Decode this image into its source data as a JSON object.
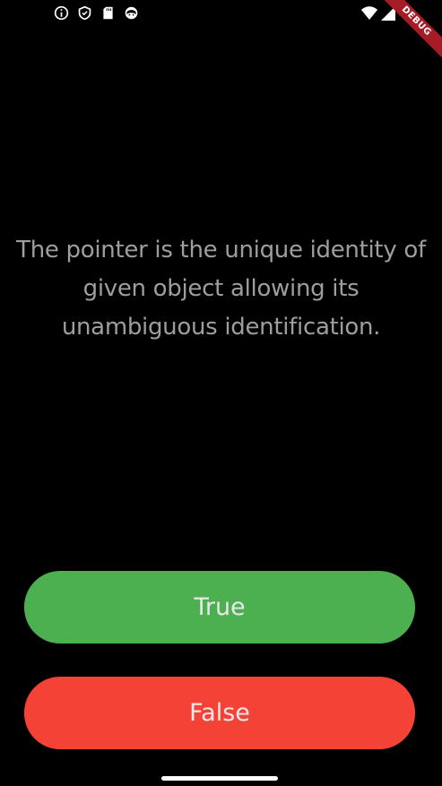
{
  "status_bar": {
    "left_icons": [
      "info-icon",
      "shield-icon",
      "sd-card-icon",
      "face-icon"
    ],
    "right_icons": [
      "wifi-icon",
      "signal-icon"
    ]
  },
  "debug_banner": {
    "label": "DEBUG",
    "color": "#a51c26"
  },
  "question": {
    "text": "The pointer is the unique identity of given object allowing its unambiguous identification."
  },
  "buttons": {
    "true_label": "True",
    "false_label": "False",
    "true_color": "#4caf50",
    "false_color": "#f44336"
  }
}
